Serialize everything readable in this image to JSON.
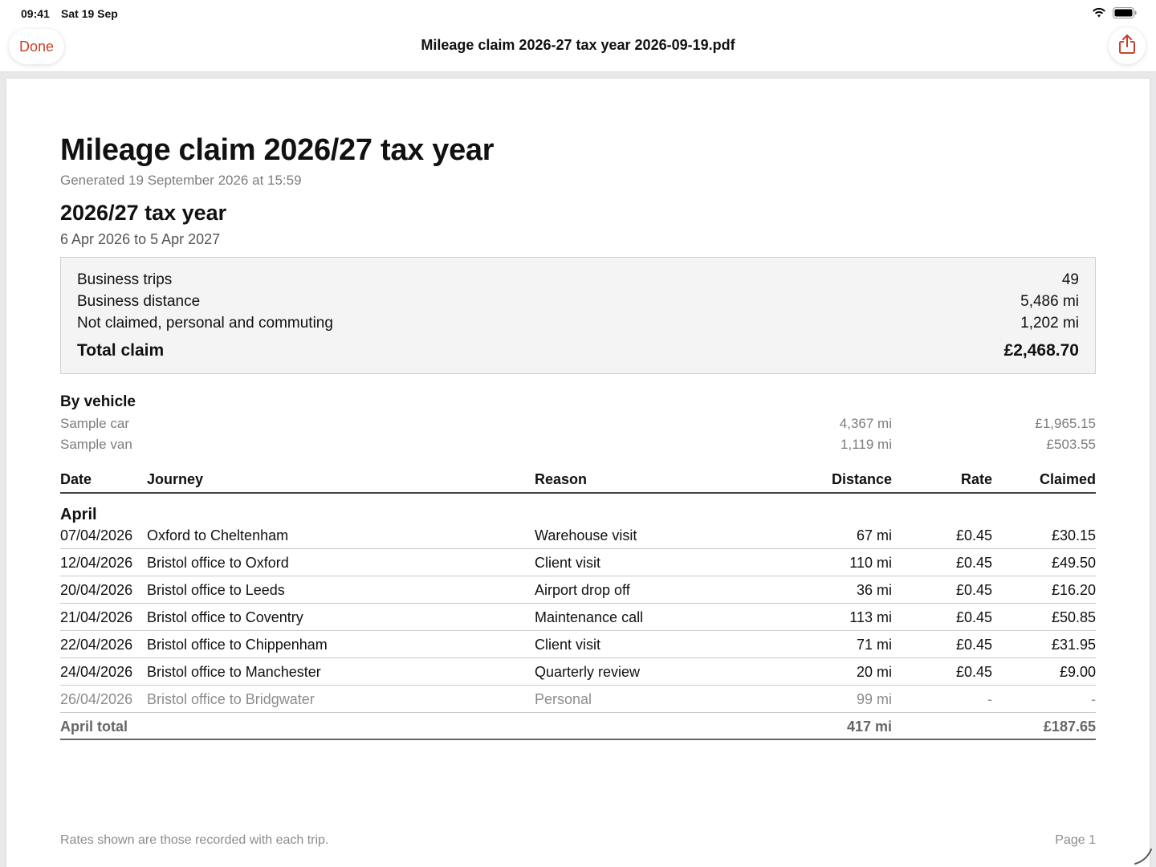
{
  "status": {
    "time": "09:41",
    "date": "Sat 19 Sep"
  },
  "nav": {
    "done_label": "Done",
    "title": "Mileage claim 2026-27 tax year 2026-09-19.pdf"
  },
  "doc": {
    "title": "Mileage claim 2026/27 tax year",
    "generated": "Generated 19 September 2026 at 15:59",
    "year_heading": "2026/27 tax year",
    "year_range": "6 Apr 2026 to 5 Apr 2027",
    "summary": [
      {
        "label": "Business trips",
        "value": "49"
      },
      {
        "label": "Business distance",
        "value": "5,486 mi"
      },
      {
        "label": "Not claimed, personal and commuting",
        "value": "1,202 mi"
      }
    ],
    "total": {
      "label": "Total claim",
      "value": "£2,468.70"
    },
    "by_vehicle": {
      "title": "By vehicle",
      "rows": [
        {
          "name": "Sample car",
          "distance": "4,367 mi",
          "claimed": "£1,965.15"
        },
        {
          "name": "Sample van",
          "distance": "1,119 mi",
          "claimed": "£503.55"
        }
      ]
    },
    "columns": {
      "date": "Date",
      "journey": "Journey",
      "reason": "Reason",
      "distance": "Distance",
      "rate": "Rate",
      "claimed": "Claimed"
    },
    "month": "April",
    "trips": [
      {
        "date": "07/04/2026",
        "journey": "Oxford to Cheltenham",
        "reason": "Warehouse visit",
        "distance": "67 mi",
        "rate": "£0.45",
        "claimed": "£30.15"
      },
      {
        "date": "12/04/2026",
        "journey": "Bristol office to Oxford",
        "reason": "Client visit",
        "distance": "110 mi",
        "rate": "£0.45",
        "claimed": "£49.50"
      },
      {
        "date": "20/04/2026",
        "journey": "Bristol office to Leeds",
        "reason": "Airport drop off",
        "distance": "36 mi",
        "rate": "£0.45",
        "claimed": "£16.20"
      },
      {
        "date": "21/04/2026",
        "journey": "Bristol office to Coventry",
        "reason": "Maintenance call",
        "distance": "113 mi",
        "rate": "£0.45",
        "claimed": "£50.85"
      },
      {
        "date": "22/04/2026",
        "journey": "Bristol office to Chippenham",
        "reason": "Client visit",
        "distance": "71 mi",
        "rate": "£0.45",
        "claimed": "£31.95"
      },
      {
        "date": "24/04/2026",
        "journey": "Bristol office to Manchester",
        "reason": "Quarterly review",
        "distance": "20 mi",
        "rate": "£0.45",
        "claimed": "£9.00"
      },
      {
        "date": "26/04/2026",
        "journey": "Bristol office to Bridgwater",
        "reason": "Personal",
        "distance": "99 mi",
        "rate": "-",
        "claimed": "-"
      }
    ],
    "month_total": {
      "label": "April total",
      "distance": "417 mi",
      "claimed": "£187.65"
    },
    "footer_note": "Rates shown are those recorded with each trip.",
    "page_label": "Page 1"
  }
}
